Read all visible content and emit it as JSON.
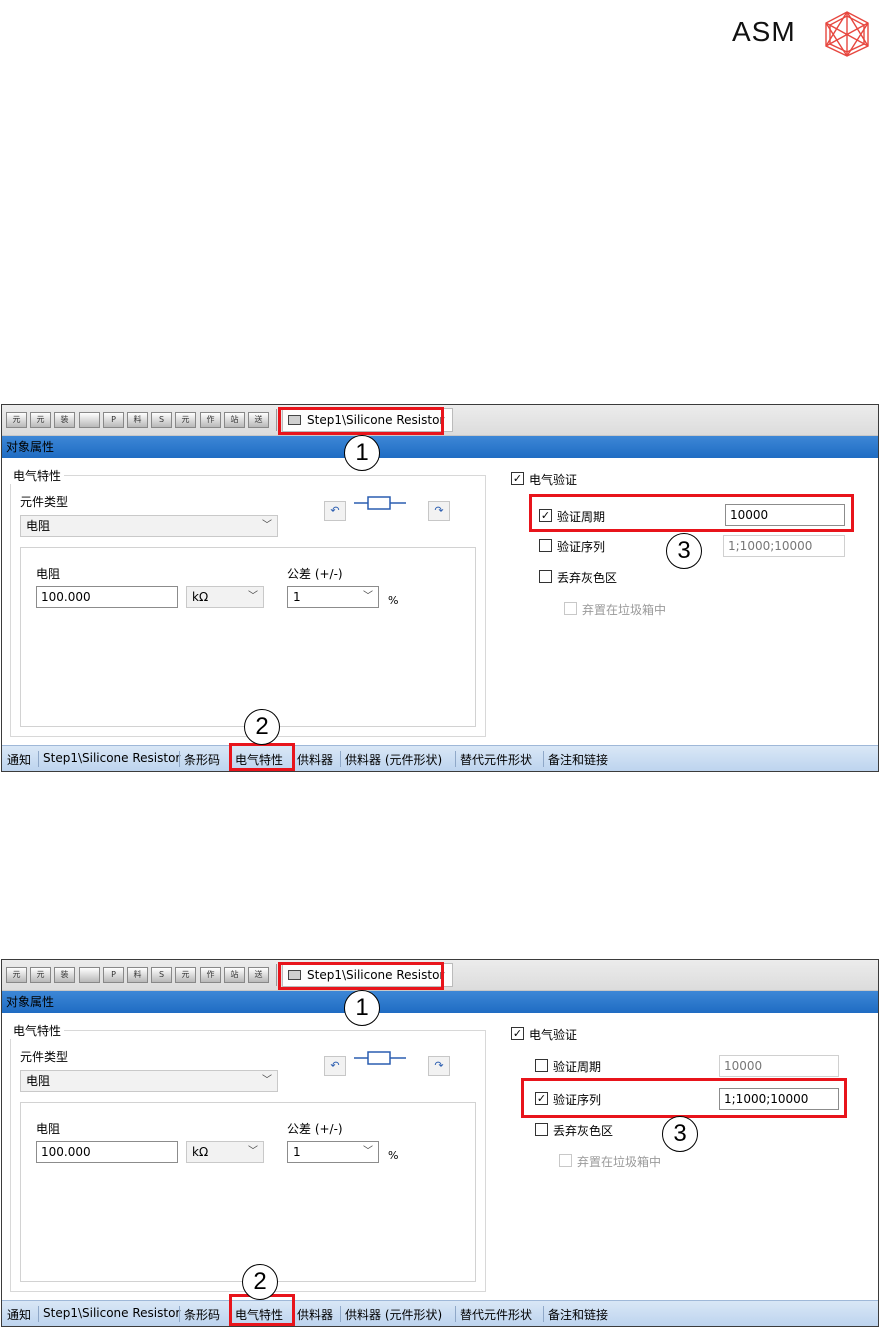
{
  "logo": {
    "text": "ASM"
  },
  "toolbar_icons": [
    {
      "name": "component-icon-1",
      "label": "元"
    },
    {
      "name": "component-icon-2",
      "label": "元"
    },
    {
      "name": "component-icon-3",
      "label": "装"
    },
    {
      "name": "component-icon-4",
      "label": ""
    },
    {
      "name": "component-icon-5",
      "label": "P"
    },
    {
      "name": "component-icon-6",
      "label": "料"
    },
    {
      "name": "component-icon-7",
      "label": "S"
    },
    {
      "name": "component-icon-8",
      "label": "元"
    },
    {
      "name": "component-icon-9",
      "label": "作"
    },
    {
      "name": "component-icon-10",
      "label": "站"
    },
    {
      "name": "component-icon-11",
      "label": "送"
    }
  ],
  "panels": [
    {
      "tab_title": "Step1\\Silicone Resistor",
      "section_title": "对象属性",
      "group_title": "电气特性",
      "component_type_label": "元件类型",
      "component_type_value": "电阻",
      "resistance_label": "电阻",
      "resistance_value": "100.000",
      "unit_value": "kΩ",
      "tolerance_label": "公差 (+/-)",
      "tolerance_value": "1",
      "percent": "%",
      "electrical_verify": {
        "label": "电气验证",
        "checked": "✓"
      },
      "verify_cycle": {
        "label": "验证周期",
        "checked": "✓",
        "value": "10000",
        "enabled": true
      },
      "verify_sequence": {
        "label": "验证序列",
        "checked": "",
        "value": "1;1000;10000",
        "enabled": false
      },
      "discard_gray": {
        "label": "丢弃灰色区",
        "checked": ""
      },
      "trash": {
        "label": "弃置在垃圾箱中",
        "checked": ""
      },
      "callouts": [
        "1",
        "2",
        "3"
      ]
    },
    {
      "tab_title": "Step1\\Silicone Resistor",
      "section_title": "对象属性",
      "group_title": "电气特性",
      "component_type_label": "元件类型",
      "component_type_value": "电阻",
      "resistance_label": "电阻",
      "resistance_value": "100.000",
      "unit_value": "kΩ",
      "tolerance_label": "公差 (+/-)",
      "tolerance_value": "1",
      "percent": "%",
      "electrical_verify": {
        "label": "电气验证",
        "checked": "✓"
      },
      "verify_cycle": {
        "label": "验证周期",
        "checked": "",
        "value": "10000",
        "enabled": false
      },
      "verify_sequence": {
        "label": "验证序列",
        "checked": "✓",
        "value": "1;1000;10000",
        "enabled": true
      },
      "discard_gray": {
        "label": "丢弃灰色区",
        "checked": ""
      },
      "trash": {
        "label": "弃置在垃圾箱中",
        "checked": ""
      },
      "callouts": [
        "1",
        "2",
        "3"
      ]
    }
  ],
  "bottom_tabs": [
    "通知",
    "Step1\\Silicone Resistor",
    "条形码",
    "电气特性",
    "供料器",
    "供料器 (元件形状)",
    "替代元件形状",
    "备注和链接"
  ],
  "colors": {
    "highlight": "#e8141b",
    "titlebar": "#1f6cc3",
    "tabbar": "#c7dbf1"
  }
}
